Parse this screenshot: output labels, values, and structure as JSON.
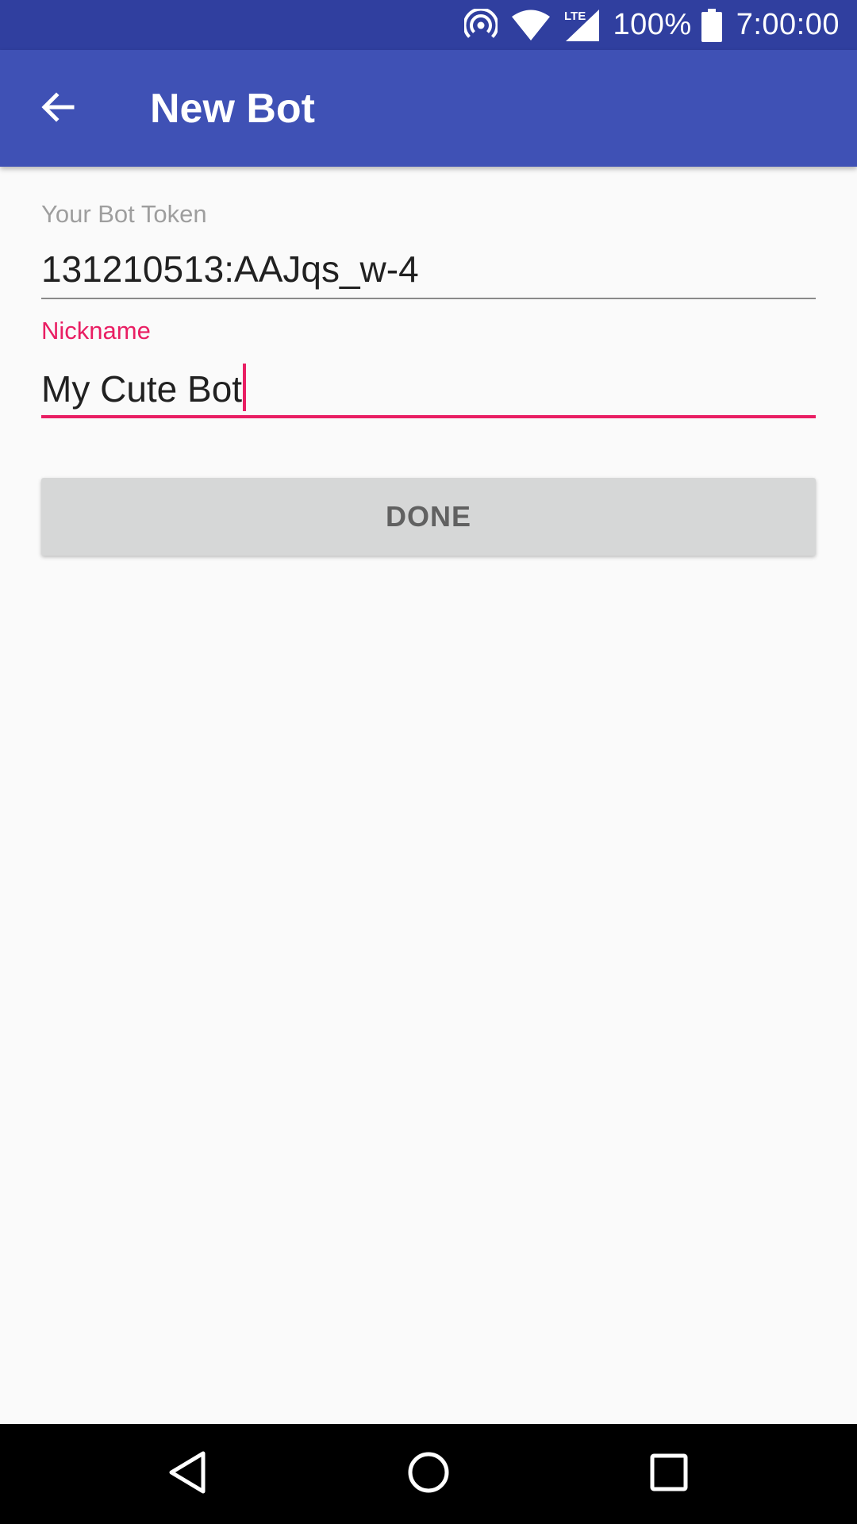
{
  "status_bar": {
    "battery_text": "100%",
    "time": "7:00:00",
    "icons": [
      "hotspot-icon",
      "wifi-icon",
      "lte-signal-icon",
      "battery-icon"
    ],
    "lte_label": "LTE"
  },
  "app_bar": {
    "title": "New Bot",
    "back_icon": "arrow-back-icon"
  },
  "form": {
    "token": {
      "label": "Your Bot Token",
      "value": "131210513:AAJqs_w-4"
    },
    "nickname": {
      "label": "Nickname",
      "value": "My Cute Bot"
    },
    "done_label": "DONE"
  },
  "nav_bar": {
    "icons": [
      "nav-back-icon",
      "nav-home-icon",
      "nav-recents-icon"
    ]
  },
  "colors": {
    "primary": "#3f51b5",
    "primary_dark": "#303f9f",
    "accent": "#e91e63",
    "background": "#fafafa",
    "button": "#d6d7d7"
  }
}
